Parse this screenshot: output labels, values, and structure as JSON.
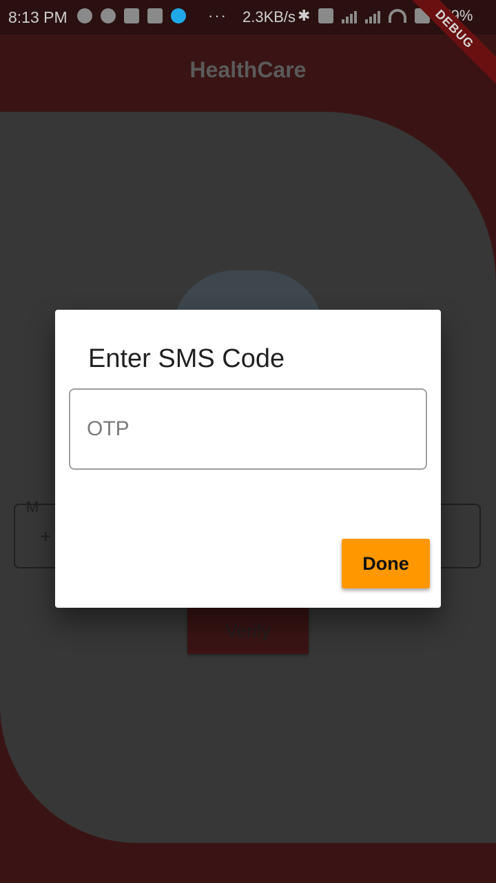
{
  "status_bar": {
    "time": "8:13 PM",
    "dots": "···",
    "speed": "2.3KB/s",
    "battery": "79%"
  },
  "app_bar": {
    "title": "HealthCare"
  },
  "debug_banner": "DEBUG",
  "form": {
    "phone_label": "M",
    "phone_prefix": "+",
    "verify_label": "Verify"
  },
  "dialog": {
    "title": "Enter SMS Code",
    "otp_placeholder": "OTP",
    "otp_value": "",
    "done_label": "Done"
  },
  "colors": {
    "app_bar_bg": "#3a1414",
    "panel_bg": "#373737",
    "accent_button": "#ff9800",
    "dialog_bg": "#ffffff"
  }
}
